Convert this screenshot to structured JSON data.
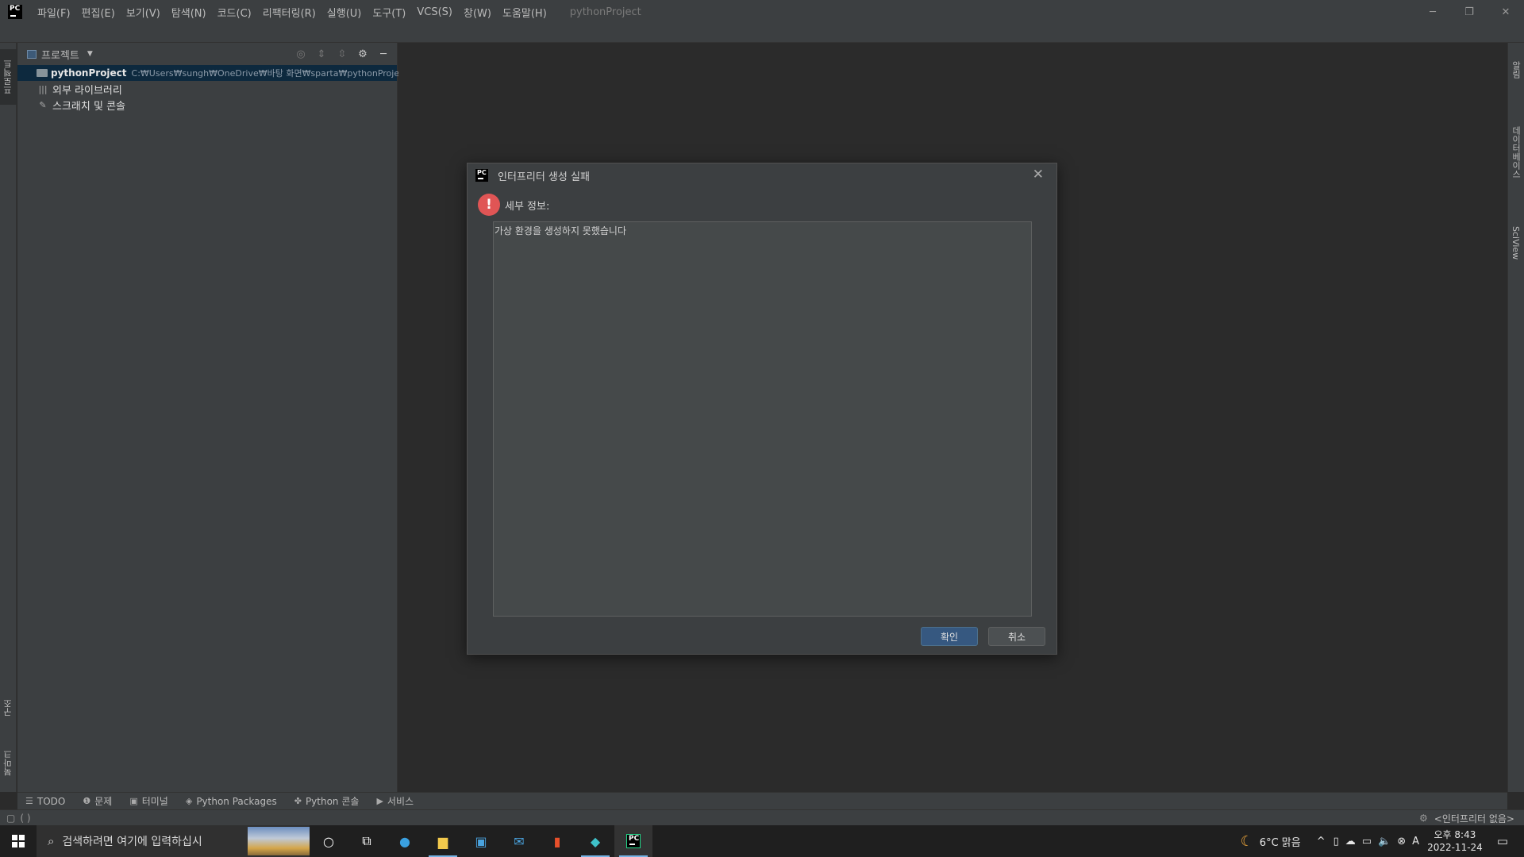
{
  "app": {
    "logo_text": "PC",
    "project_title": "pythonProject"
  },
  "menu": [
    "파일(F)",
    "편집(E)",
    "보기(V)",
    "탐색(N)",
    "코드(C)",
    "리팩터링(R)",
    "실행(U)",
    "도구(T)",
    "VCS(S)",
    "창(W)",
    "도움말(H)"
  ],
  "window_controls": {
    "minimize": "─",
    "restore": "❐",
    "close": "✕"
  },
  "left_tool_tabs": {
    "project": "프로젝트",
    "structure": "구조",
    "bookmarks": "북마크"
  },
  "right_tool_tabs": {
    "notifications": "알림",
    "database": "데이터베이스",
    "sciview": "SciView"
  },
  "project_panel": {
    "title": "프로젝트",
    "tree": [
      {
        "name": "pythonProject",
        "path": "C:₩Users₩sungh₩OneDrive₩바탕 화면₩sparta₩pythonProject"
      },
      {
        "name": "외부 라이브러리"
      },
      {
        "name": "스크래치 및 콘솔"
      }
    ]
  },
  "dialog": {
    "title": "인터프리터 생성 실패",
    "detail_label": "세부 정보:",
    "message": "가상 환경을 생성하지 못했습니다",
    "ok_label": "확인",
    "cancel_label": "취소"
  },
  "bottom_tabs": [
    "TODO",
    "문제",
    "터미널",
    "Python Packages",
    "Python 콘솔",
    "서비스"
  ],
  "status": {
    "interpreter": "<인터프리터 없음>"
  },
  "taskbar": {
    "search_placeholder": "검색하려면 여기에 입력하십시",
    "weather": "6°C  맑음",
    "time": "오후 8:43",
    "date": "2022-11-24",
    "ime": "A"
  }
}
